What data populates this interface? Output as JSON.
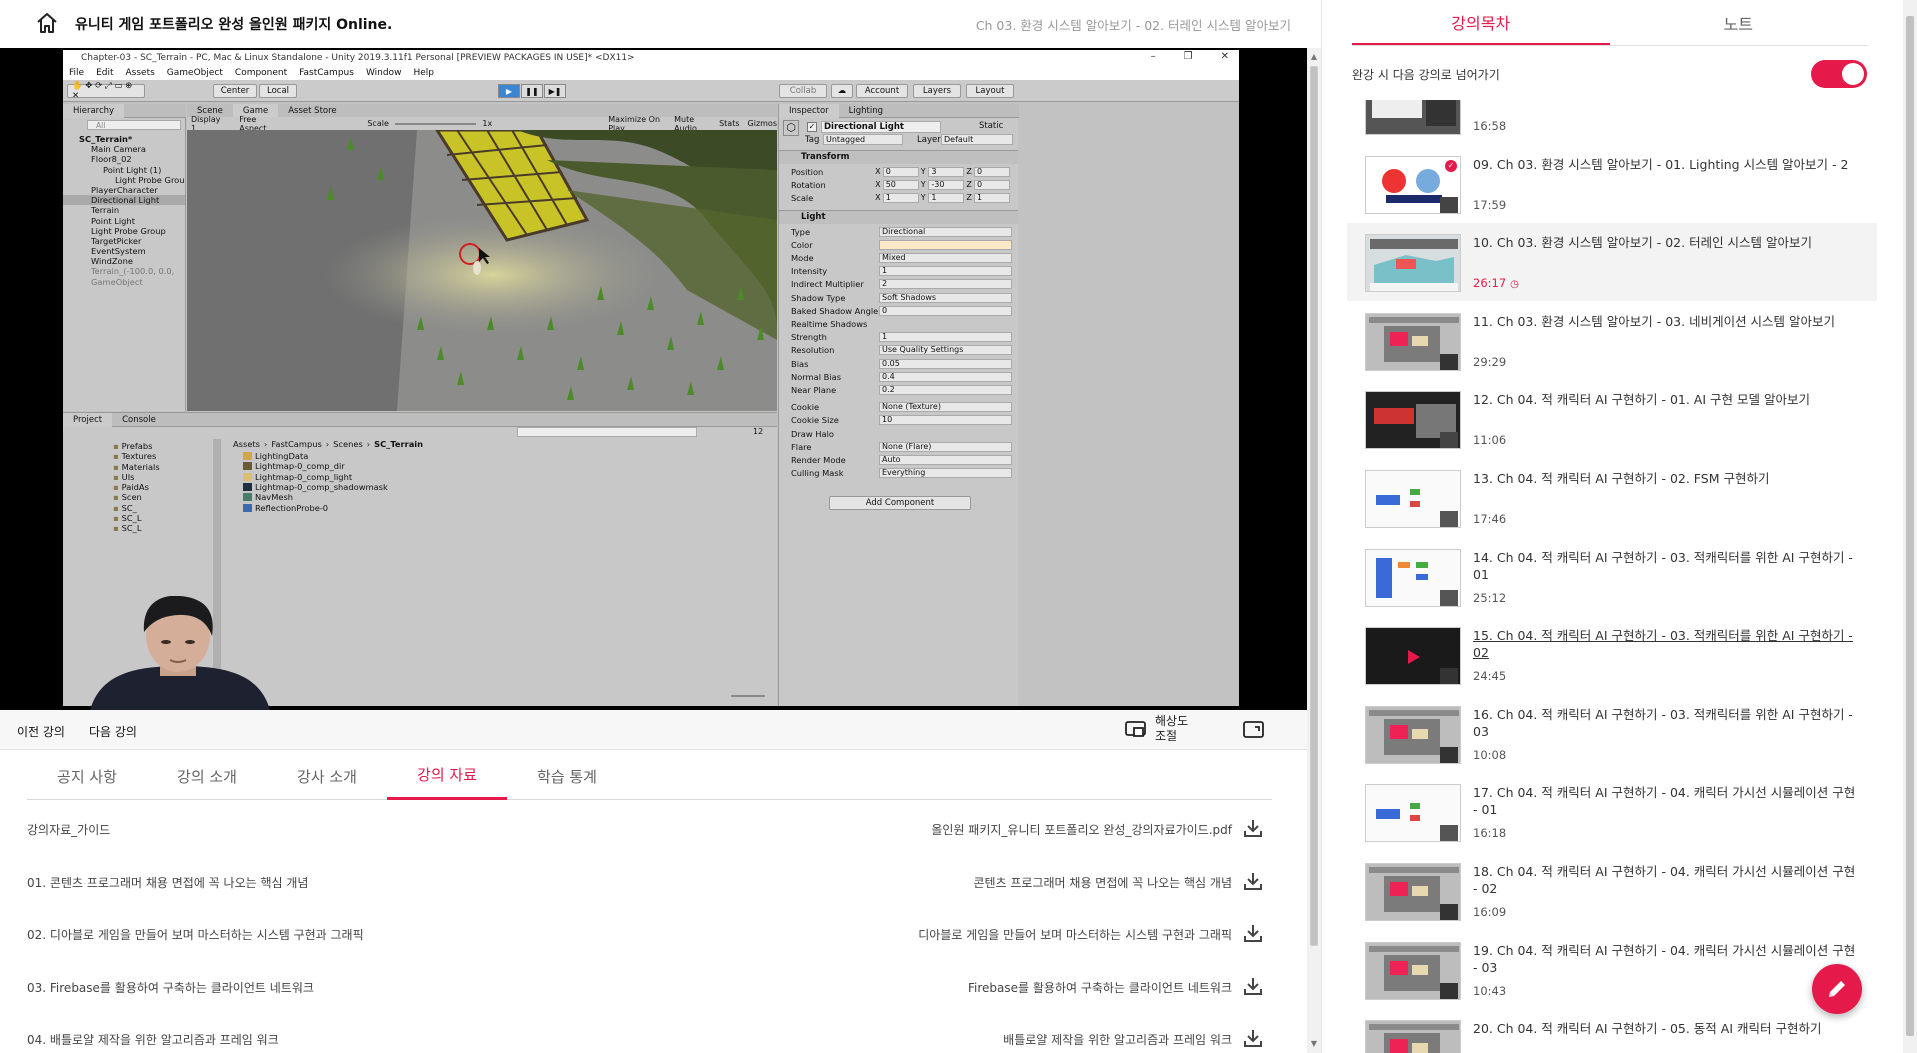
{
  "header": {
    "course_title": "유니티 게임 포트폴리오 완성 올인원 패키지 Online.",
    "chapter_title": "Ch 03. 환경 시스템 알아보기 - 02. 터레인 시스템 알아보기"
  },
  "video": {
    "progress_fraction": 0.8,
    "unity": {
      "window_title": "Chapter-03 - SC_Terrain - PC, Mac & Linux Standalone - Unity 2019.3.11f1 Personal [PREVIEW PACKAGES IN USE]* <DX11>",
      "menu": [
        "File",
        "Edit",
        "Assets",
        "GameObject",
        "Component",
        "FastCampus",
        "Window",
        "Help"
      ],
      "toolbar": {
        "center": "Center",
        "local": "Local",
        "collab": "Collab",
        "account": "Account",
        "layers": "Layers",
        "layout": "Layout"
      },
      "hierarchy_tab": "Hierarchy",
      "hierarchy_search": "All",
      "hierarchy": [
        {
          "label": "SC_Terrain*",
          "indent": 1,
          "bold": true
        },
        {
          "label": "Main Camera",
          "indent": 2
        },
        {
          "label": "Floor8_02",
          "indent": 2
        },
        {
          "label": "Point Light (1)",
          "indent": 3
        },
        {
          "label": "Light Probe Grou",
          "indent": 4
        },
        {
          "label": "PlayerCharacter",
          "indent": 2
        },
        {
          "label": "Directional Light",
          "indent": 2,
          "selected": true
        },
        {
          "label": "Terrain",
          "indent": 2
        },
        {
          "label": "Point Light",
          "indent": 2
        },
        {
          "label": "Light Probe Group",
          "indent": 2
        },
        {
          "label": "TargetPicker",
          "indent": 2
        },
        {
          "label": "EventSystem",
          "indent": 2
        },
        {
          "label": "WindZone",
          "indent": 2
        },
        {
          "label": "Terrain_(-100.0, 0.0,",
          "indent": 2,
          "dim": true
        },
        {
          "label": "GameObject",
          "indent": 2,
          "dim": true
        }
      ],
      "view_tabs": [
        "Scene",
        "Game",
        "Asset Store"
      ],
      "game_bar": {
        "display": "Display 1",
        "aspect": "Free Aspect",
        "scale_label": "Scale",
        "scale_value": "1x",
        "maximize": "Maximize On Play",
        "mute": "Mute Audio",
        "stats": "Stats",
        "gizmos": "Gizmos"
      },
      "inspector_tabs": [
        "Inspector",
        "Lighting"
      ],
      "inspector": {
        "object_name": "Directional Light",
        "static": "Static",
        "tag_label": "Tag",
        "tag": "Untagged",
        "layer_label": "Layer",
        "layer": "Default",
        "transform_title": "Transform",
        "transform_rows": [
          {
            "label": "Position",
            "x": "0",
            "y": "3",
            "z": "0"
          },
          {
            "label": "Rotation",
            "x": "50",
            "y": "-30",
            "z": "0"
          },
          {
            "label": "Scale",
            "x": "1",
            "y": "1",
            "z": "1"
          }
        ],
        "light_title": "Light",
        "light_rows": [
          {
            "label": "Type",
            "value": "Directional"
          },
          {
            "label": "Color",
            "value": ""
          },
          {
            "label": "Mode",
            "value": "Mixed"
          },
          {
            "label": "Intensity",
            "value": "1"
          },
          {
            "label": "Indirect Multiplier",
            "value": "2"
          },
          {
            "label": "Shadow Type",
            "value": "Soft Shadows"
          },
          {
            "label": "Baked Shadow Angle",
            "value": "0"
          },
          {
            "label": "Realtime Shadows",
            "value": ""
          },
          {
            "label": "Strength",
            "value": "1"
          },
          {
            "label": "Resolution",
            "value": "Use Quality Settings"
          },
          {
            "label": "Bias",
            "value": "0.05"
          },
          {
            "label": "Normal Bias",
            "value": "0.4"
          },
          {
            "label": "Near Plane",
            "value": "0.2"
          },
          {
            "label": "Cookie",
            "value": "None (Texture)"
          },
          {
            "label": "Cookie Size",
            "value": "10"
          },
          {
            "label": "Draw Halo",
            "value": ""
          },
          {
            "label": "Flare",
            "value": "None (Flare)"
          },
          {
            "label": "Render Mode",
            "value": "Auto"
          },
          {
            "label": "Culling Mask",
            "value": "Everything"
          }
        ],
        "add_component": "Add Component"
      },
      "project_tabs": [
        "Project",
        "Console"
      ],
      "project_count": "12",
      "project_folders": [
        "Prefabs",
        "Textures",
        "Materials",
        "UIs",
        "PaidAs",
        "Scen",
        "SC_",
        "SC_L",
        "SC_L"
      ],
      "breadcrumb": [
        "Assets",
        "FastCampus",
        "Scenes",
        "SC_Terrain"
      ],
      "assets": [
        "LightingData",
        "Lightmap-0_comp_dir",
        "Lightmap-0_comp_light",
        "Lightmap-0_comp_shadowmask",
        "NavMesh",
        "ReflectionProbe-0"
      ]
    }
  },
  "controls": {
    "prev": "이전 강의",
    "next": "다음 강의",
    "resolution": "해상도 조절"
  },
  "tabs": [
    {
      "label": "공지 사항",
      "active": false
    },
    {
      "label": "강의 소개",
      "active": false
    },
    {
      "label": "강사 소개",
      "active": false
    },
    {
      "label": "강의 자료",
      "active": true
    },
    {
      "label": "학습 통계",
      "active": false
    }
  ],
  "materials": [
    {
      "title": "강의자료_가이드",
      "file": "올인원 패키지_유니티 포트폴리오 완성_강의자료가이드.pdf"
    },
    {
      "title": "01. 콘텐츠 프로그래머 채용 면접에 꼭 나오는 핵심 개념",
      "file": "콘텐츠 프로그래머 채용 면접에 꼭 나오는 핵심 개념"
    },
    {
      "title": "02. 디아블로 게임을 만들어 보며 마스터하는 시스템 구현과 그래픽",
      "file": "디아블로 게임을 만들어 보며 마스터하는 시스템 구현과 그래픽"
    },
    {
      "title": "03. Firebase를 활용하여 구축하는 클라이언트 네트워크",
      "file": "Firebase를 활용하여 구축하는 클라이언트 네트워크"
    },
    {
      "title": "04. 배틀로얄 제작을 위한 알고리즘과 프레임 워크",
      "file": "배틀로얄 제작을 위한 알고리즘과 프레임 워크"
    }
  ],
  "sidebar": {
    "tabs": [
      {
        "label": "강의목차",
        "active": true
      },
      {
        "label": "노트",
        "active": false
      }
    ],
    "autoplay_label": "완강 시 다음 강의로 넘어가기",
    "autoplay_on": true,
    "lessons": [
      {
        "title": "",
        "time": "16:58",
        "thumb": "unity-dark",
        "state": "done"
      },
      {
        "title": "09. Ch 03. 환경 시스템 알아보기 - 01. Lighting 시스템 알아보기 - 2",
        "time": "17:59",
        "thumb": "light-probes",
        "state": "done"
      },
      {
        "title": "10. Ch 03. 환경 시스템 알아보기 - 02. 터레인 시스템 알아보기",
        "time": "26:17",
        "thumb": "terrain",
        "state": "current"
      },
      {
        "title": "11. Ch 03. 환경 시스템 알아보기 - 03. 네비게이션 시스템 알아보기",
        "time": "29:29",
        "thumb": "unity-gray",
        "state": "normal"
      },
      {
        "title": "12. Ch 04. 적 캐릭터 AI 구현하기 - 01. AI 구현 모델 알아보기",
        "time": "11:06",
        "thumb": "title-dark",
        "state": "normal"
      },
      {
        "title": "13. Ch 04. 적 캐릭터 AI 구현하기 - 02. FSM 구현하기",
        "time": "17:46",
        "thumb": "diagram-white",
        "state": "normal"
      },
      {
        "title": "14. Ch 04. 적 캐릭터 AI 구현하기 - 03. 적캐릭터를 위한 AI 구현하기 - 01",
        "time": "25:12",
        "thumb": "diagram-blocks",
        "state": "normal"
      },
      {
        "title": "15. Ch 04. 적 캐릭터 AI 구현하기 - 03. 적캐릭터를 위한 AI 구현하기 - 02",
        "time": "24:45",
        "thumb": "play-dark",
        "state": "hover"
      },
      {
        "title": "16. Ch 04. 적 캐릭터 AI 구현하기 - 03. 적캐릭터를 위한 AI 구현하기 - 03",
        "time": "10:08",
        "thumb": "unity-gray",
        "state": "normal"
      },
      {
        "title": "17. Ch 04. 적 캐릭터 AI 구현하기 - 04. 캐릭터 가시선 시뮬레이션 구현 - 01",
        "time": "16:18",
        "thumb": "diagram-white",
        "state": "normal"
      },
      {
        "title": "18. Ch 04. 적 캐릭터 AI 구현하기 - 04. 캐릭터 가시선 시뮬레이션 구현 - 02",
        "time": "16:09",
        "thumb": "unity-gray",
        "state": "normal"
      },
      {
        "title": "19. Ch 04. 적 캐릭터 AI 구현하기 - 04. 캐릭터 가시선 시뮬레이션 구현 - 03",
        "time": "10:43",
        "thumb": "unity-gray",
        "state": "normal"
      },
      {
        "title": "20. Ch 04. 적 캐릭터 AI 구현하기 - 05. 동적 AI 캐릭터 구현하기",
        "time": "",
        "thumb": "unity-gray",
        "state": "normal"
      }
    ]
  },
  "colors": {
    "accent": "#e5194a",
    "text": "#333333",
    "muted": "#999999"
  },
  "icons": {
    "home": "home-icon",
    "download": "download-icon",
    "resolution": "resolution-icon",
    "expand": "expand-icon",
    "edit": "pencil-icon",
    "check": "check-circle-icon",
    "clock": "clock-icon"
  }
}
